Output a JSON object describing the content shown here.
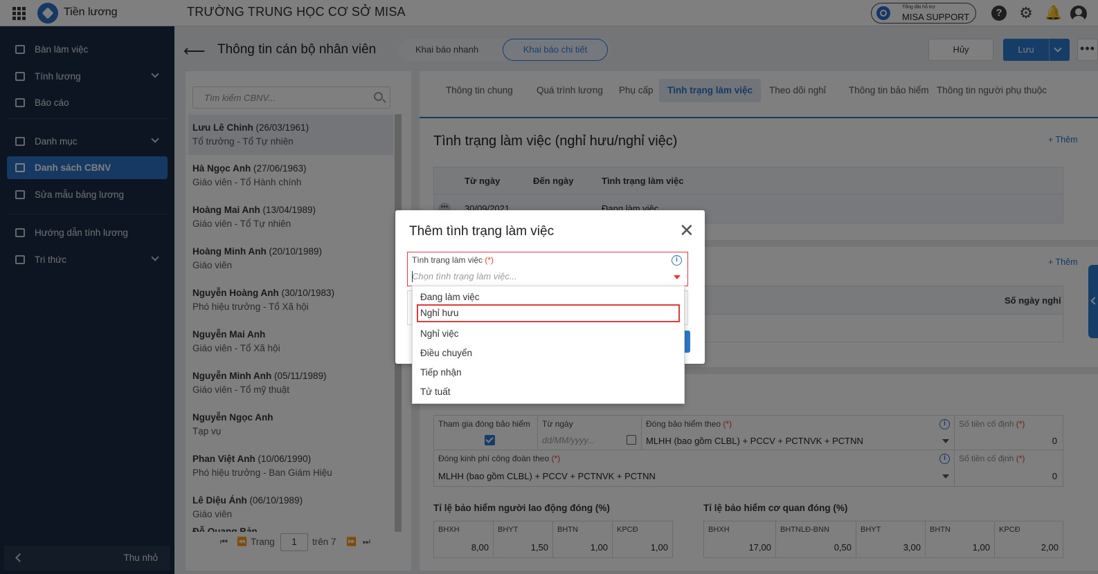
{
  "app": {
    "name": "Tiền lương",
    "school": "TRƯỜNG TRUNG HỌC CƠ SỞ MISA",
    "support_small": "Tổng đài hỗ trợ",
    "support_big": "MISA SUPPORT"
  },
  "sidebar": {
    "items": [
      {
        "label": "Bàn làm việc"
      },
      {
        "label": "Tính lương"
      },
      {
        "label": "Báo cáo"
      },
      {
        "label": "Danh mục"
      },
      {
        "label": "Danh sách CBNV"
      },
      {
        "label": "Sửa mẫu bảng lương"
      },
      {
        "label": "Hướng dẫn tính lương"
      },
      {
        "label": "Tri thức"
      }
    ],
    "collapse_label": "Thu nhỏ"
  },
  "header": {
    "title": "Thông tin cán bộ nhân viên",
    "seg_quick": "Khai báo nhanh",
    "seg_detail": "Khai báo chi tiết",
    "cancel": "Hủy",
    "save": "Lưu",
    "more": "•••"
  },
  "list": {
    "search_placeholder": "Tìm kiếm CBNV...",
    "employees": [
      {
        "name": "Lưu Lê Chinh",
        "dob": " (26/03/1961)",
        "sub": "Tổ trưởng - Tổ Tự nhiên"
      },
      {
        "name": "Hà Ngọc Anh",
        "dob": " (27/06/1963)",
        "sub": "Giáo viên - Tổ Hành chính"
      },
      {
        "name": "Hoàng Mai Anh",
        "dob": " (13/04/1989)",
        "sub": "Giáo viên - Tổ Tự nhiên"
      },
      {
        "name": "Hoàng Minh Anh",
        "dob": " (20/10/1989)",
        "sub": "Giáo viên"
      },
      {
        "name": "Nguyễn Hoàng Anh",
        "dob": " (30/10/1983)",
        "sub": "Phó hiệu trưởng - Tổ Xã hội"
      },
      {
        "name": "Nguyễn Mai Anh",
        "dob": "",
        "sub": "Giáo viên - Tổ Xã hội"
      },
      {
        "name": "Nguyễn Minh Anh",
        "dob": " (05/11/1989)",
        "sub": "Giáo viên - Tổ mỹ thuật"
      },
      {
        "name": "Nguyễn Ngọc Anh",
        "dob": "",
        "sub": "Tạp vụ"
      },
      {
        "name": "Phan Việt Anh",
        "dob": " (10/06/1990)",
        "sub": "Phó hiệu trưởng - Ban Giám Hiệu"
      },
      {
        "name": "Lê Diệu Ánh",
        "dob": " (06/10/1989)",
        "sub": "Giáo viên"
      },
      {
        "name": "Đỗ Quang Bản",
        "dob": "",
        "sub": ""
      }
    ],
    "pager": {
      "label": "Trang",
      "page": "1",
      "total": "trên 7"
    }
  },
  "tabs": [
    "Thông tin chung",
    "Quá trình lương",
    "Phụ cấp",
    "Tình trạng làm việc",
    "Theo dõi nghỉ",
    "Thông tin bảo hiểm",
    "Thông tin người phụ thuộc"
  ],
  "work_status": {
    "title": "Tình trạng làm việc (nghỉ hưu/nghỉ việc)",
    "add": "+ Thêm",
    "columns": [
      "Từ ngày",
      "Đến ngày",
      "Tình trạng làm việc"
    ],
    "row": {
      "from": "30/09/2021",
      "to": "",
      "status": "Đang làm việc"
    }
  },
  "leave": {
    "add": "+ Thêm",
    "col_days": "Số ngày nghỉ"
  },
  "insurance": {
    "join_label": "Tham gia đóng bảo hiểm",
    "from_label": "Từ ngày",
    "from_placeholder": "dd/MM/yyyy...",
    "basis_label": "Đóng bảo hiểm theo",
    "basis_value": "MLHH (bao gồm CLBL) + PCCV + PCTNVK + PCTNN",
    "fixed_label": "Số tiền cố định",
    "fixed_value": "0",
    "union_label": "Đóng kinh phí công đoàn theo",
    "union_value": "MLHH (bao gồm CLBL) + PCCV + PCTNVK + PCTNN",
    "fixed2_label": "Số tiền cố định",
    "fixed2_value": "0",
    "required_mark": "(*)",
    "employee_rate_title": "Tỉ lệ bảo hiểm người lao động đóng (%)",
    "employee_rates": [
      {
        "label": "BHXH",
        "value": "8,00"
      },
      {
        "label": "BHYT",
        "value": "1,50"
      },
      {
        "label": "BHTN",
        "value": "1,00"
      },
      {
        "label": "KPCĐ",
        "value": "1,00"
      }
    ],
    "agency_rate_title": "Tỉ lệ bảo hiểm cơ quan đóng (%)",
    "agency_rates": [
      {
        "label": "BHXH",
        "value": "17,00"
      },
      {
        "label": "BHTNLĐ-BNN",
        "value": "0,50"
      },
      {
        "label": "BHYT",
        "value": "3,00"
      },
      {
        "label": "BHTN",
        "value": "1,00"
      },
      {
        "label": "KPCĐ",
        "value": "2,00"
      }
    ]
  },
  "dialog": {
    "title": "Thêm tình trạng làm việc",
    "field_label": "Tình trạng làm việc",
    "required_mark": "(*)",
    "placeholder": "Chọn tình trạng làm việc...",
    "options": [
      "Đang làm việc",
      "Nghỉ hưu",
      "Nghỉ việc",
      "Điều chuyển",
      "Tiếp nhận",
      "Tử tuất"
    ],
    "highlighted_option": "Nghỉ hưu"
  },
  "colors": {
    "accent": "#2c79d0",
    "sidebar": "#1b2b45",
    "error": "#e23b3b"
  }
}
